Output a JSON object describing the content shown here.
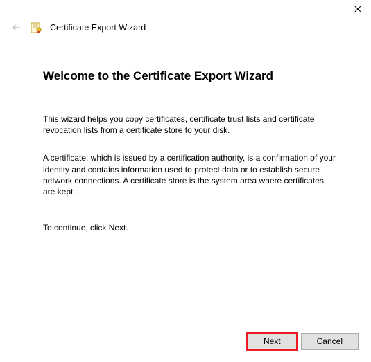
{
  "titlebar": {
    "close_icon": "close"
  },
  "header": {
    "back_icon": "back-arrow",
    "app_icon": "certificate",
    "wizard_title": "Certificate Export Wizard"
  },
  "content": {
    "heading": "Welcome to the Certificate Export Wizard",
    "intro_para": "This wizard helps you copy certificates, certificate trust lists and certificate revocation lists from a certificate store to your disk.",
    "explain_para": "A certificate, which is issued by a certification authority, is a confirmation of your identity and contains information used to protect data or to establish secure network connections. A certificate store is the system area where certificates are kept.",
    "continue_para": "To continue, click Next."
  },
  "footer": {
    "next_label": "Next",
    "cancel_label": "Cancel"
  }
}
